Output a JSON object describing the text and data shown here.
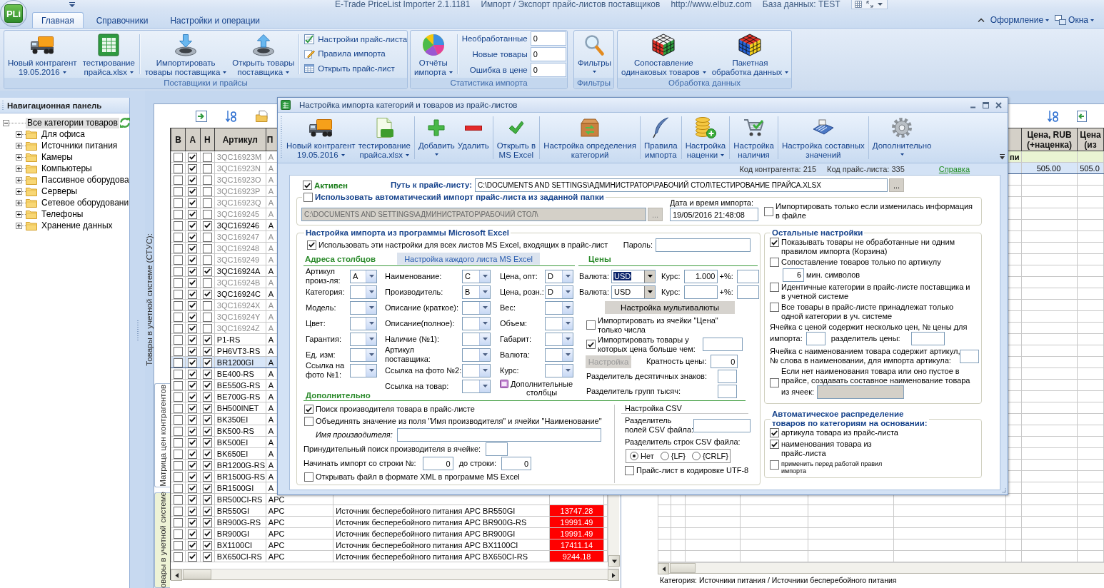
{
  "title_bar": {
    "logo": "PLi",
    "texts": [
      "E-Trade PriceList Importer 2.1.1181",
      "Импорт / Экспорт прайс-листов поставщиков",
      "http://www.elbuz.com",
      "База данных: TEST"
    ]
  },
  "ribbon": {
    "tabs": [
      {
        "label": "Главная",
        "selected": true
      },
      {
        "label": "Справочники",
        "selected": false
      },
      {
        "label": "Настройки и операции",
        "selected": false
      }
    ],
    "menus": [
      "Оформление",
      "Окна"
    ],
    "groups": [
      {
        "title": "Поставщики и прайсы",
        "button_sets": [
          [
            {
              "label": "Новый контрагент\n19.05.2016",
              "dropdown": true
            },
            {
              "label": "тестирование\nпрайса.xlsx",
              "dropdown": true
            }
          ],
          [
            {
              "label": "Импортировать\nтовары поставщика",
              "dropdown": true
            },
            {
              "label": "Открыть товары\nпоставщика",
              "dropdown": true
            }
          ]
        ],
        "small_buttons": [
          "Настройки прайс-листа",
          "Правила импорта",
          "Открыть прайс-лист"
        ]
      },
      {
        "title": "Статистика импорта",
        "button_sets": [
          [
            {
              "label": "Отчёты\nимпорта",
              "dropdown": true
            }
          ]
        ],
        "stats": [
          {
            "label": "Необработанные",
            "value": "0"
          },
          {
            "label": "Новые товары",
            "value": "0"
          },
          {
            "label": "Ошибка в цене",
            "value": "0"
          }
        ]
      },
      {
        "title": "Фильтры",
        "button_sets": [
          [
            {
              "label": "Фильтры",
              "dropdown": true
            }
          ]
        ]
      },
      {
        "title": "Обработка данных",
        "button_sets": [
          [
            {
              "label": "Сопоставление\nодинаковых товаров",
              "dropdown": true
            },
            {
              "label": "Пакетная\nобработка данных",
              "dropdown": true
            }
          ]
        ]
      }
    ]
  },
  "nav_panel": {
    "title": "Навигационная панель",
    "tree": [
      {
        "label": "Все категории товаров",
        "expanded": true,
        "selected": true,
        "children": [
          {
            "label": "Для офиса",
            "expanded": false,
            "selected": false
          },
          {
            "label": "Источники питания",
            "expanded": false,
            "selected": false
          },
          {
            "label": "Камеры",
            "expanded": false,
            "selected": false
          },
          {
            "label": "Компьютеры",
            "expanded": false,
            "selected": false
          },
          {
            "label": "Пассивное оборудова",
            "expanded": false,
            "selected": false
          },
          {
            "label": "Серверы",
            "expanded": false,
            "selected": false
          },
          {
            "label": "Сетевое оборудовани",
            "expanded": false,
            "selected": false
          },
          {
            "label": "Телефоны",
            "expanded": false,
            "selected": false
          },
          {
            "label": "Хранение данных",
            "expanded": false,
            "selected": false
          }
        ]
      }
    ]
  },
  "side_tabs": {
    "caption": "Товары в учетной системе (СТУС):",
    "tabs": [
      {
        "label": "Матрица цен контрагентов",
        "selected": true
      },
      {
        "label": "овары в учетной системе",
        "selected": false
      }
    ]
  },
  "products_grid": {
    "columns": [
      "В",
      "А",
      "Н",
      "Артикул",
      "П"
    ],
    "rows": [
      {
        "checks": [
          false,
          true,
          false
        ],
        "article": "3QC16923M",
        "maker": "A",
        "selected": false
      },
      {
        "checks": [
          false,
          true,
          false
        ],
        "article": "3QC16923N",
        "maker": "A",
        "selected": false
      },
      {
        "checks": [
          false,
          true,
          false
        ],
        "article": "3QC16923O",
        "maker": "A",
        "selected": false
      },
      {
        "checks": [
          false,
          true,
          false
        ],
        "article": "3QC16923P",
        "maker": "A",
        "selected": false
      },
      {
        "checks": [
          false,
          true,
          false
        ],
        "article": "3QC16923Q",
        "maker": "A",
        "selected": false
      },
      {
        "checks": [
          false,
          true,
          false
        ],
        "article": "3QC169245",
        "maker": "A",
        "selected": false
      },
      {
        "checks": [
          false,
          true,
          true
        ],
        "article": "3QC169246",
        "maker": "A",
        "selected": false
      },
      {
        "checks": [
          false,
          true,
          false
        ],
        "article": "3QC169247",
        "maker": "A",
        "selected": false
      },
      {
        "checks": [
          false,
          true,
          false
        ],
        "article": "3QC169248",
        "maker": "A",
        "selected": false
      },
      {
        "checks": [
          false,
          true,
          false
        ],
        "article": "3QC169249",
        "maker": "A",
        "selected": false
      },
      {
        "checks": [
          false,
          true,
          true
        ],
        "article": "3QC16924A",
        "maker": "A",
        "selected": false
      },
      {
        "checks": [
          false,
          true,
          false
        ],
        "article": "3QC16924B",
        "maker": "A",
        "selected": false
      },
      {
        "checks": [
          false,
          true,
          true
        ],
        "article": "3QC16924C",
        "maker": "A",
        "selected": false
      },
      {
        "checks": [
          false,
          true,
          false
        ],
        "article": "3QC16924X",
        "maker": "A",
        "selected": false
      },
      {
        "checks": [
          false,
          true,
          false
        ],
        "article": "3QC16924Y",
        "maker": "A",
        "selected": false
      },
      {
        "checks": [
          false,
          true,
          false
        ],
        "article": "3QC16924Z",
        "maker": "A",
        "selected": false
      },
      {
        "checks": [
          false,
          true,
          true
        ],
        "article": "P1-RS",
        "maker": "A",
        "selected": false
      },
      {
        "checks": [
          false,
          true,
          true
        ],
        "article": "PH6VT3-RS",
        "maker": "A",
        "selected": false
      },
      {
        "checks": [
          false,
          true,
          true
        ],
        "article": "BR1200GI",
        "maker": "A",
        "selected": true
      },
      {
        "checks": [
          false,
          true,
          true
        ],
        "article": "BE400-RS",
        "maker": "A",
        "selected": false
      },
      {
        "checks": [
          false,
          true,
          true
        ],
        "article": "BE550G-RS",
        "maker": "A",
        "selected": false
      },
      {
        "checks": [
          false,
          true,
          true
        ],
        "article": "BE700G-RS",
        "maker": "A",
        "selected": false
      },
      {
        "checks": [
          false,
          true,
          true
        ],
        "article": "BH500INET",
        "maker": "A",
        "selected": false
      },
      {
        "checks": [
          false,
          true,
          true
        ],
        "article": "BK350EI",
        "maker": "A",
        "selected": false
      },
      {
        "checks": [
          false,
          true,
          true
        ],
        "article": "BK500-RS",
        "maker": "A",
        "selected": false
      },
      {
        "checks": [
          false,
          true,
          true
        ],
        "article": "BK500EI",
        "maker": "A",
        "selected": false
      },
      {
        "checks": [
          false,
          true,
          true
        ],
        "article": "BK650EI",
        "maker": "A",
        "selected": false
      },
      {
        "checks": [
          false,
          true,
          true
        ],
        "article": "BR1200G-RS",
        "maker": "A",
        "selected": false
      },
      {
        "checks": [
          false,
          true,
          true
        ],
        "article": "BR1500G-RS",
        "maker": "A",
        "selected": false
      },
      {
        "checks": [
          false,
          true,
          true
        ],
        "article": "BR1500GI",
        "maker": "A",
        "selected": false
      },
      {
        "checks": [
          false,
          true,
          true
        ],
        "article": "BR500CI-RS",
        "maker": "APC",
        "selected": false
      },
      {
        "checks": [
          false,
          true,
          true
        ],
        "article": "BR550GI",
        "maker": "APC",
        "name": "Источник бесперебойного питания APC BR550GI",
        "price": "13747.28",
        "color": "#ff0000",
        "selected": false
      },
      {
        "checks": [
          false,
          true,
          true
        ],
        "article": "BR900G-RS",
        "maker": "APC",
        "name": "Источник бесперебойного питания APC BR900G-RS",
        "price": "19991.49",
        "color": "#ff0000",
        "selected": false
      },
      {
        "checks": [
          false,
          true,
          true
        ],
        "article": "BR900GI",
        "maker": "APC",
        "name": "Источник бесперебойного питания APC BR900GI",
        "price": "19991.49",
        "color": "#ff0000",
        "selected": false
      },
      {
        "checks": [
          false,
          true,
          true
        ],
        "article": "BX1100CI",
        "maker": "APC",
        "name": "Источник бесперебойного питания APC BX1100CI",
        "price": "17411.14",
        "color": "#ff0000",
        "selected": false
      },
      {
        "checks": [
          false,
          true,
          true
        ],
        "article": "BX650CI-RS",
        "maker": "APC",
        "name": "Источник бесперебойного питания APC BX650CI-RS",
        "price": "9244.18",
        "color": "#ff0000",
        "selected": false
      }
    ]
  },
  "prices_grid": {
    "columns": [
      "Цена, RUB (+наценка)",
      "Цена (из"
    ],
    "group_row": "пи",
    "rows": [
      {
        "cells": [
          "505.00",
          "505.0"
        ],
        "selected": true
      }
    ]
  },
  "status_bar": "Категория: Источники питания / Источники бесперебойного питания",
  "dialog": {
    "title": "Настройка импорта категорий и товаров из прайс-листов",
    "toolbar": [
      [
        {
          "label": "Новый контрагент\n19.05.2016",
          "dropdown": true
        },
        {
          "label": "тестирование\nпрайса.xlsx",
          "dropdown": true
        }
      ],
      [
        {
          "label": "Добавить",
          "dropdown": true
        },
        {
          "label": "Удалить",
          "dropdown": false
        }
      ],
      [
        {
          "label": "Открыть в\nMS Excel",
          "dropdown": false
        }
      ],
      [
        {
          "label": "Настройка определения\nкатегорий",
          "dropdown": false
        }
      ],
      [
        {
          "label": "Правила\nимпорта",
          "dropdown": false
        }
      ],
      [
        {
          "label": "Настройка\nнаценки",
          "dropdown": true
        }
      ],
      [
        {
          "label": "Настройка\nналичия",
          "dropdown": false
        }
      ],
      [
        {
          "label": "Настройка составных\nзначений",
          "dropdown": false
        }
      ],
      [
        {
          "label": "Дополнительно",
          "dropdown": true
        }
      ]
    ],
    "info": [
      "Код контрагента: 215",
      "Код прайс-листа: 335"
    ],
    "help_link": "Справка",
    "active": {
      "label": "Активен",
      "checked": true
    },
    "path": {
      "label": "Путь к прайс-листу:",
      "value": "C:\\DOCUMENTS AND SETTINGS\\АДМИНИСТРАТОР\\РАБОЧИЙ СТОЛ\\ТЕСТИРОВАНИЕ ПРАЙСА.XLSX",
      "button": "..."
    },
    "auto_import": {
      "label": "Использовать автоматический импорт прайс-листа из заданной папки",
      "checked": false,
      "folder": "C:\\DOCUMENTS AND SETTINGS\\АДМИНИСТРАТОР\\РАБОЧИЙ СТОЛ\\",
      "button": "...",
      "date_label": "Дата и время импорта:",
      "date": "19/05/2016 21:48:08",
      "only_changed": {
        "label": "Импортировать только если изменилась информация\nв файле",
        "checked": false
      }
    },
    "excel": {
      "title": "Настройка импорта из программы Microsoft Excel",
      "all_sheets": {
        "label": "Использовать эти настройки для всех листов MS Excel, входящих в прайс-лист",
        "checked": true
      },
      "password_label": "Пароль:",
      "addresses_title": "Адреса столбцов",
      "sheets_button": "Настройка каждого листа MS Excel",
      "prices_title": "Цены",
      "address_columns": [
        [
          {
            "label": "Артикул\nпроиз-ля:",
            "value": "A"
          },
          {
            "label": "Категория:"
          },
          {
            "label": "Модель:"
          },
          {
            "label": "Цвет:"
          },
          {
            "label": "Гарантия:"
          },
          {
            "label": "Ед. изм:"
          },
          {
            "label": "Ссылка на\nфото №1:"
          }
        ],
        [
          {
            "label": "Наименование:",
            "value": "C"
          },
          {
            "label": "Производитель:",
            "value": "B"
          },
          {
            "label": "Описание (краткое):"
          },
          {
            "label": "Описание(полное):"
          },
          {
            "label": "Наличие (№1):"
          },
          {
            "label": "Артикул\nпоставщика:"
          },
          {
            "label": "Ссылка на фото №2:"
          },
          {
            "label": "Ссылка на товар:"
          }
        ],
        [
          {
            "label": "Цена, опт:",
            "value": "D"
          },
          {
            "label": "Цена, розн.:",
            "value": "D"
          },
          {
            "label": "Вес:"
          },
          {
            "label": "Объем:"
          },
          {
            "label": "Габарит:"
          },
          {
            "label": "Валюта:"
          },
          {
            "label": "Курс:"
          }
        ]
      ],
      "extra_columns_button": "Дополнительные\nстолбцы",
      "currencies": [
        {
          "label": "Валюта:",
          "value": "USD",
          "focused": true,
          "rate_label": "Курс:",
          "rate": "1.000",
          "percent_label": "+%:"
        },
        {
          "label": "Валюта:",
          "value": "USD",
          "focused": false,
          "rate_label": "Курс:",
          "percent_label": "+%:"
        }
      ],
      "multicurrency_button": "Настройка мультивалюты",
      "numbers_only": {
        "label": "Импортировать из ячейки \"Цена\"\nтолько числа",
        "checked": false
      },
      "min_price": {
        "label": "Импортировать товары у\nкоторых цена больше чем:",
        "checked": true
      },
      "setup_button": {
        "label": "Настройка",
        "disabled": true
      },
      "price_multiple": {
        "label": "Кратность цены:",
        "value": "0"
      },
      "decimal_separator_label": "Разделитель десятичных знаков:",
      "thousands_separator_label": "Разделитель групп тысяч:",
      "extra_title": "Дополнительно",
      "find_maker": {
        "label": "Поиск производителя товара в прайс-листе",
        "checked": true
      },
      "merge_maker": {
        "label": "Объединять значение из поля \"Имя производителя\" и ячейки \"Наименование\"",
        "checked": false
      },
      "maker_name_label": "Имя производителя:",
      "forced_search_label": "Принудительный поиск производителя в ячейке:",
      "start_row": {
        "label": "Начинать импорт со строки №:",
        "value": "0"
      },
      "end_row": {
        "label": "до строки:",
        "value": "0"
      },
      "open_xml": {
        "label": "Открывать файл в формате XML в программе MS Excel",
        "checked": false
      },
      "csv": {
        "title": "Настройка CSV",
        "field_separator_label": "Разделитель\nполей CSV файла:",
        "row_separator_label": "Разделитель строк CSV файла:",
        "row_separators": [
          {
            "label": "Нет",
            "selected": true
          },
          {
            "label": "{LF}",
            "selected": false
          },
          {
            "label": "{CRLF}",
            "selected": false
          }
        ],
        "utf8": {
          "label": "Прайс-лист в кодировке UTF-8",
          "checked": false
        }
      }
    },
    "other": {
      "title": "Остальные настройки",
      "show_unprocessed": {
        "label": "Показывать товары не обработанные ни одним\nправилом импорта (Корзина)",
        "checked": true
      },
      "match_by_article": {
        "label": "Сопоставление товаров только по артикулу",
        "checked": false
      },
      "min_chars": {
        "value": "6",
        "label": "мин. символов"
      },
      "identical_categories": {
        "label": "Идентичные категории в прайс-листе поставщика и\nв учетной системе",
        "checked": false
      },
      "single_category": {
        "label": "Все товары в прайс-листе принадлежат только\nодной категории в уч. системе",
        "checked": false
      },
      "price_index": {
        "label_lines": [
          "Ячейка с ценой содержит несколько цен, № цены для",
          "импорта:"
        ],
        "separator_label": "разделитель цены:"
      },
      "article_word": {
        "label": "Ячейка с наименованием товара содержит артикул,\n№ слова в наименовании, для импорта артикула:"
      },
      "composite_name": {
        "label_lines": [
          "Если нет наименования товара или оно пустое в\nпрайсе, создавать составное наименование товара",
          "из ячеек:"
        ],
        "checked": false
      }
    },
    "auto_distribution": {
      "title": "Автоматическое распределение\nтоваров по категориям на основании:",
      "options": [
        {
          "label": "артикула товара из прайс-листа",
          "checked": true,
          "kind": "normal"
        },
        {
          "label": "наименования товара из\nпрайс-листа",
          "checked": true,
          "kind": "normal"
        },
        {
          "label": "применить перед работой правил\nимпорта",
          "checked": false,
          "kind": "small"
        }
      ]
    }
  }
}
